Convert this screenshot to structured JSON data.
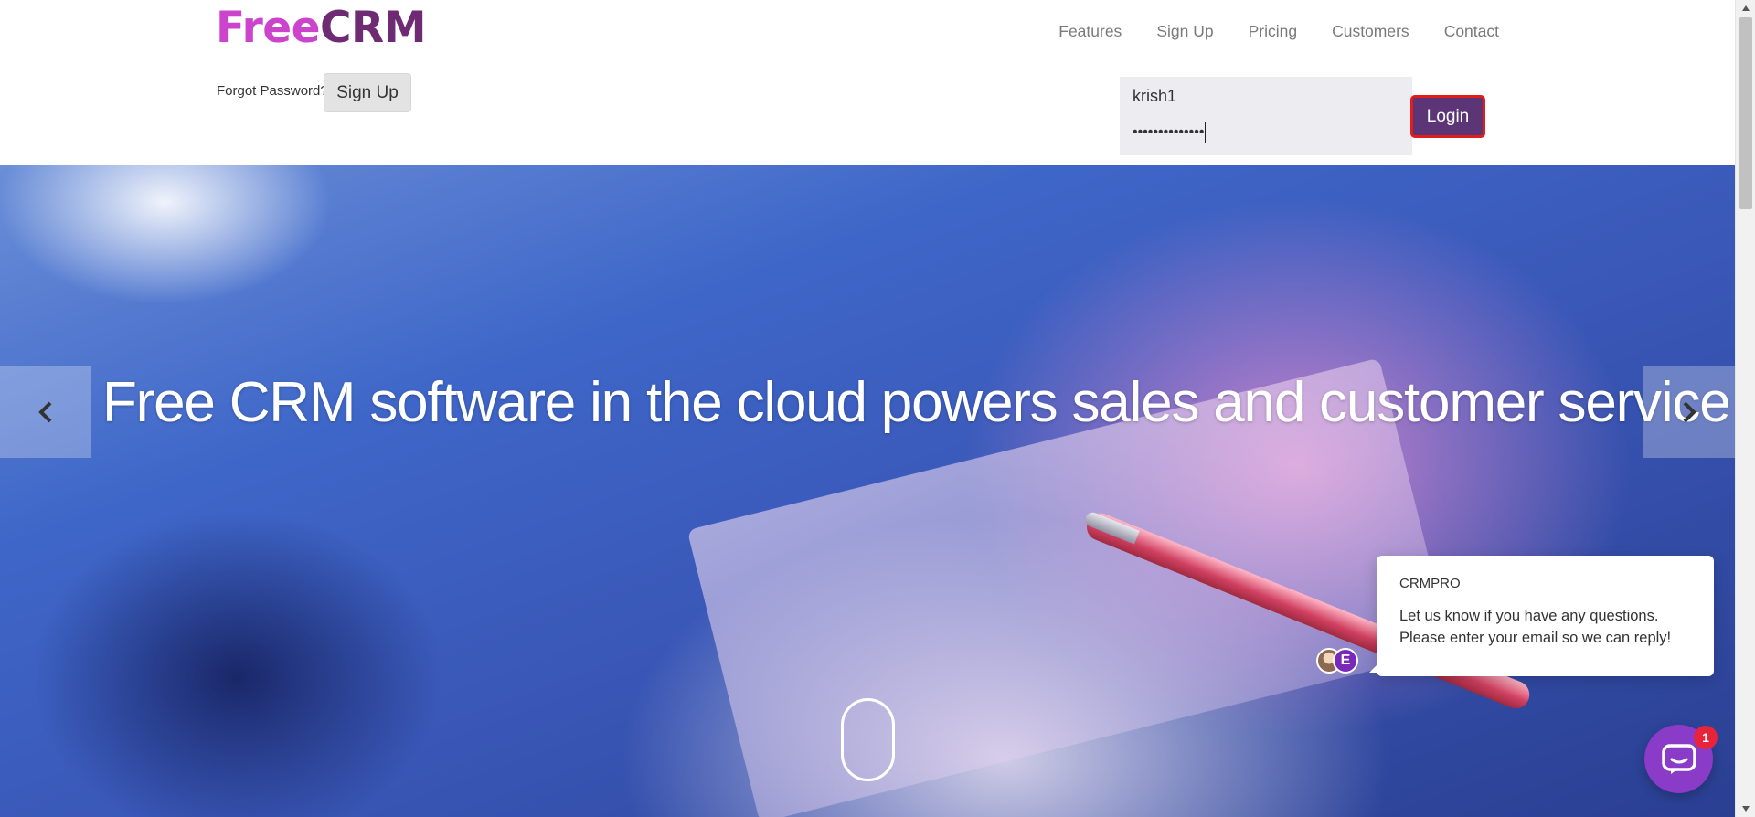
{
  "header": {
    "logo": {
      "part1": "Free",
      "part2": "CRM"
    },
    "nav": [
      {
        "label": "Features"
      },
      {
        "label": "Sign Up"
      },
      {
        "label": "Pricing"
      },
      {
        "label": "Customers"
      },
      {
        "label": "Contact"
      }
    ],
    "forgot_password": "Forgot Password?",
    "signup_button": "Sign Up",
    "login": {
      "username_value": "krish1",
      "password_value": "••••••••••••••",
      "button_label": "Login"
    }
  },
  "hero": {
    "title": "Free CRM software in the cloud powers sales and customer service"
  },
  "chat": {
    "title": "CRMPRO",
    "message": "Let us know if you have any questions. Please enter your email so we can reply!",
    "avatar_letter": "E",
    "badge_count": "1"
  },
  "colors": {
    "logo_free": "#cc44cc",
    "logo_crm": "#6e2a72",
    "login_button": "#5b3575",
    "login_border": "#e21b1b",
    "chat_launcher": "#8a3bc7",
    "badge": "#e8243b"
  },
  "icons": {
    "carousel_prev": "chevron-left-icon",
    "carousel_next": "chevron-right-icon",
    "chat_launcher": "chat-bubble-icon",
    "scroll_indicator": "mouse-scroll-icon"
  }
}
